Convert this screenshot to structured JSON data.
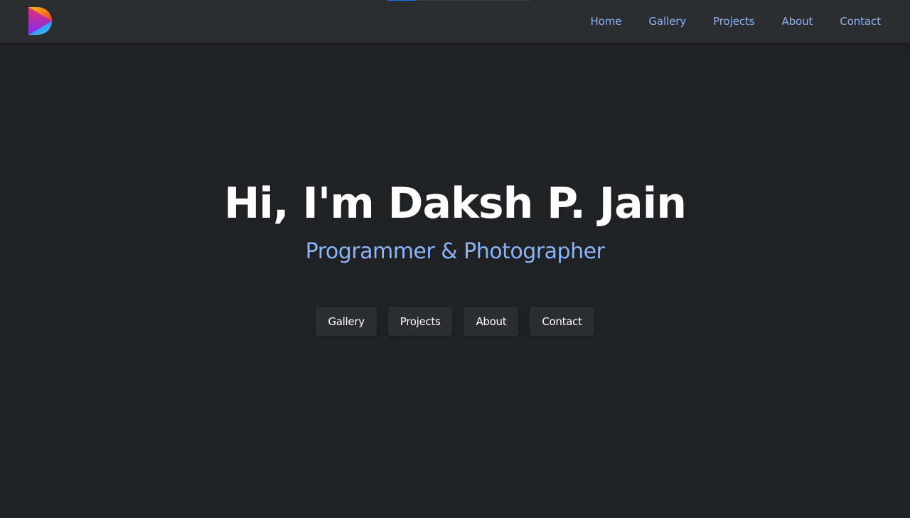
{
  "header": {
    "logo_icon": "brand-d-logo-icon",
    "reading_progress": 0.2,
    "colors": {
      "background": "#2c2d31",
      "link": "#8ab4f8",
      "progress": "#1a73e8"
    },
    "nav": [
      {
        "label": "Home"
      },
      {
        "label": "Gallery"
      },
      {
        "label": "Projects"
      },
      {
        "label": "About"
      },
      {
        "label": "Contact"
      }
    ]
  },
  "hero": {
    "title": "Hi, I'm Daksh P. Jain",
    "subtitle": "Programmer & Photographer",
    "buttons": [
      {
        "label": "Gallery"
      },
      {
        "label": "Projects"
      },
      {
        "label": "About"
      },
      {
        "label": "Contact"
      }
    ],
    "colors": {
      "background": "#202124",
      "title": "#ffffff",
      "subtitle": "#8ab4f8",
      "button_bg": "#2c2d31"
    }
  }
}
